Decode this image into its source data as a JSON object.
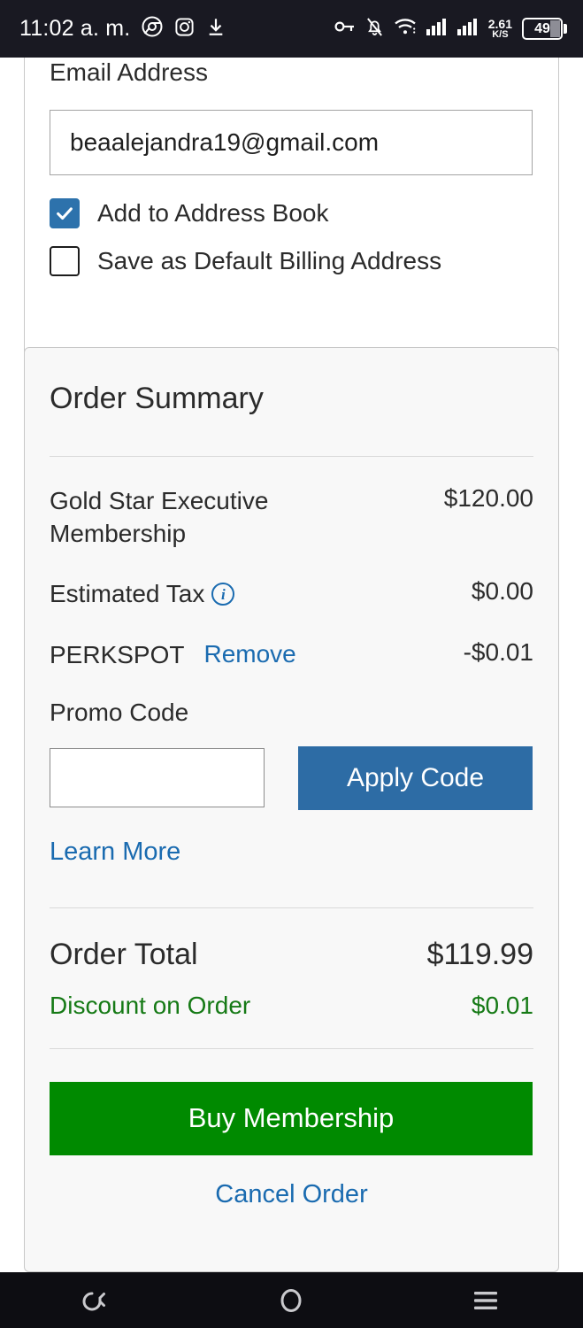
{
  "status_bar": {
    "time": "11:02 a. m.",
    "left_icons": [
      "chrome-icon",
      "instagram-icon",
      "download-icon"
    ],
    "right_icons": [
      "vpn-key-icon",
      "notifications-muted-icon",
      "wifi-icon",
      "signal-bars-icon",
      "signal-bars-2-icon"
    ],
    "network_speed_value": "2.61",
    "network_speed_unit": "K/S",
    "battery_level": "49"
  },
  "billing": {
    "email_label": "Email Address",
    "email_value": "beaalejandra19@gmail.com",
    "email_placeholder": "Email Address",
    "checkbox_address_book": {
      "label": "Add to Address Book",
      "checked": true
    },
    "checkbox_default_billing": {
      "label": "Save as Default Billing Address",
      "checked": false
    }
  },
  "order_summary": {
    "title": "Order Summary",
    "lines": [
      {
        "name": "Gold Star Executive Membership",
        "value": "$120.00"
      },
      {
        "name": "Estimated Tax",
        "value": "$0.00",
        "info_icon": "info-circle-icon"
      },
      {
        "name": "PERKSPOT",
        "action_label": "Remove",
        "value": "-$0.01"
      }
    ],
    "promo_label": "Promo Code",
    "promo_value": "",
    "promo_placeholder": "",
    "apply_button": "Apply Code",
    "learn_more": "Learn More",
    "order_total_label": "Order Total",
    "order_total_value": "$119.99",
    "discount_label": "Discount on Order",
    "discount_value": "$0.01",
    "buy_button": "Buy Membership",
    "cancel_link": "Cancel Order"
  },
  "nav_bar": {
    "back": "back-icon",
    "home": "home-icon",
    "menu": "menu-icon"
  },
  "colors": {
    "accent_blue": "#2d6ca5",
    "link_blue": "#1a6bb0",
    "buy_green": "#008a00",
    "discount_green": "#167a16",
    "checkbox_blue": "#2d72ac",
    "panel_bg": "#f8f8f8"
  }
}
